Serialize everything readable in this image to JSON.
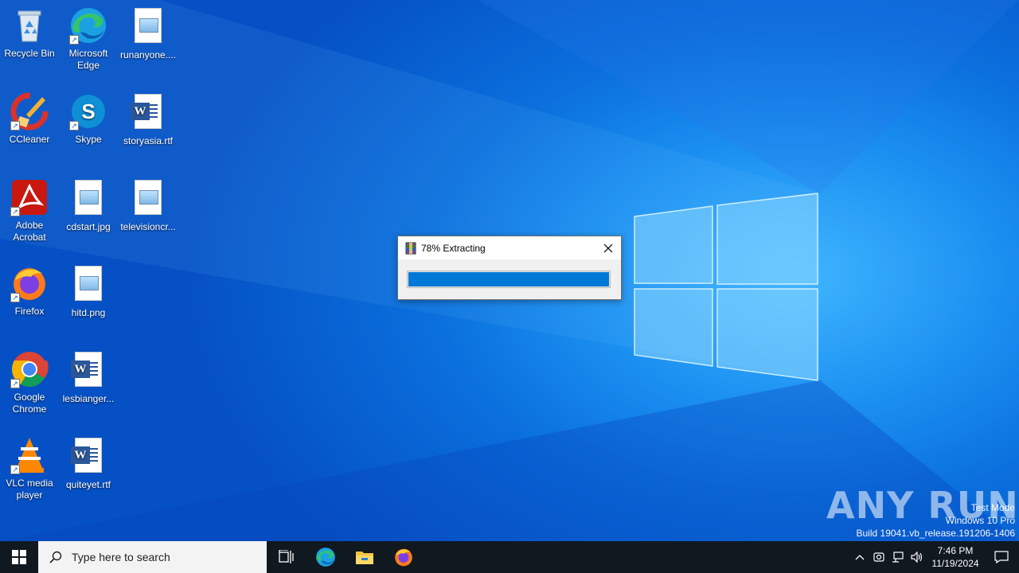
{
  "desktop": {
    "icons": {
      "recycle_bin": "Recycle Bin",
      "edge": "Microsoft Edge",
      "runanyone": "runanyone....",
      "ccleaner": "CCleaner",
      "skype": "Skype",
      "storyasia": "storyasia.rtf",
      "acrobat": "Adobe Acrobat",
      "cdstart": "cdstart.jpg",
      "televisioncr": "televisioncr...",
      "firefox": "Firefox",
      "hitd": "hitd.png",
      "chrome": "Google Chrome",
      "lesbianger": "lesbianger...",
      "vlc": "VLC media player",
      "quiteyet": "quiteyet.rtf"
    }
  },
  "dialog": {
    "title": "78% Extracting",
    "progress": 1.0
  },
  "watermark": {
    "brand": "ANY RUN",
    "line1": "Test Mode",
    "line2": "Windows 10 Pro",
    "line3": "Build 19041.vb_release.191206-1406"
  },
  "taskbar": {
    "search_placeholder": "Type here to search",
    "time": "7:46 PM",
    "date": "11/19/2024"
  },
  "colors": {
    "accent": "#0078d7",
    "taskbar": "#101820"
  }
}
